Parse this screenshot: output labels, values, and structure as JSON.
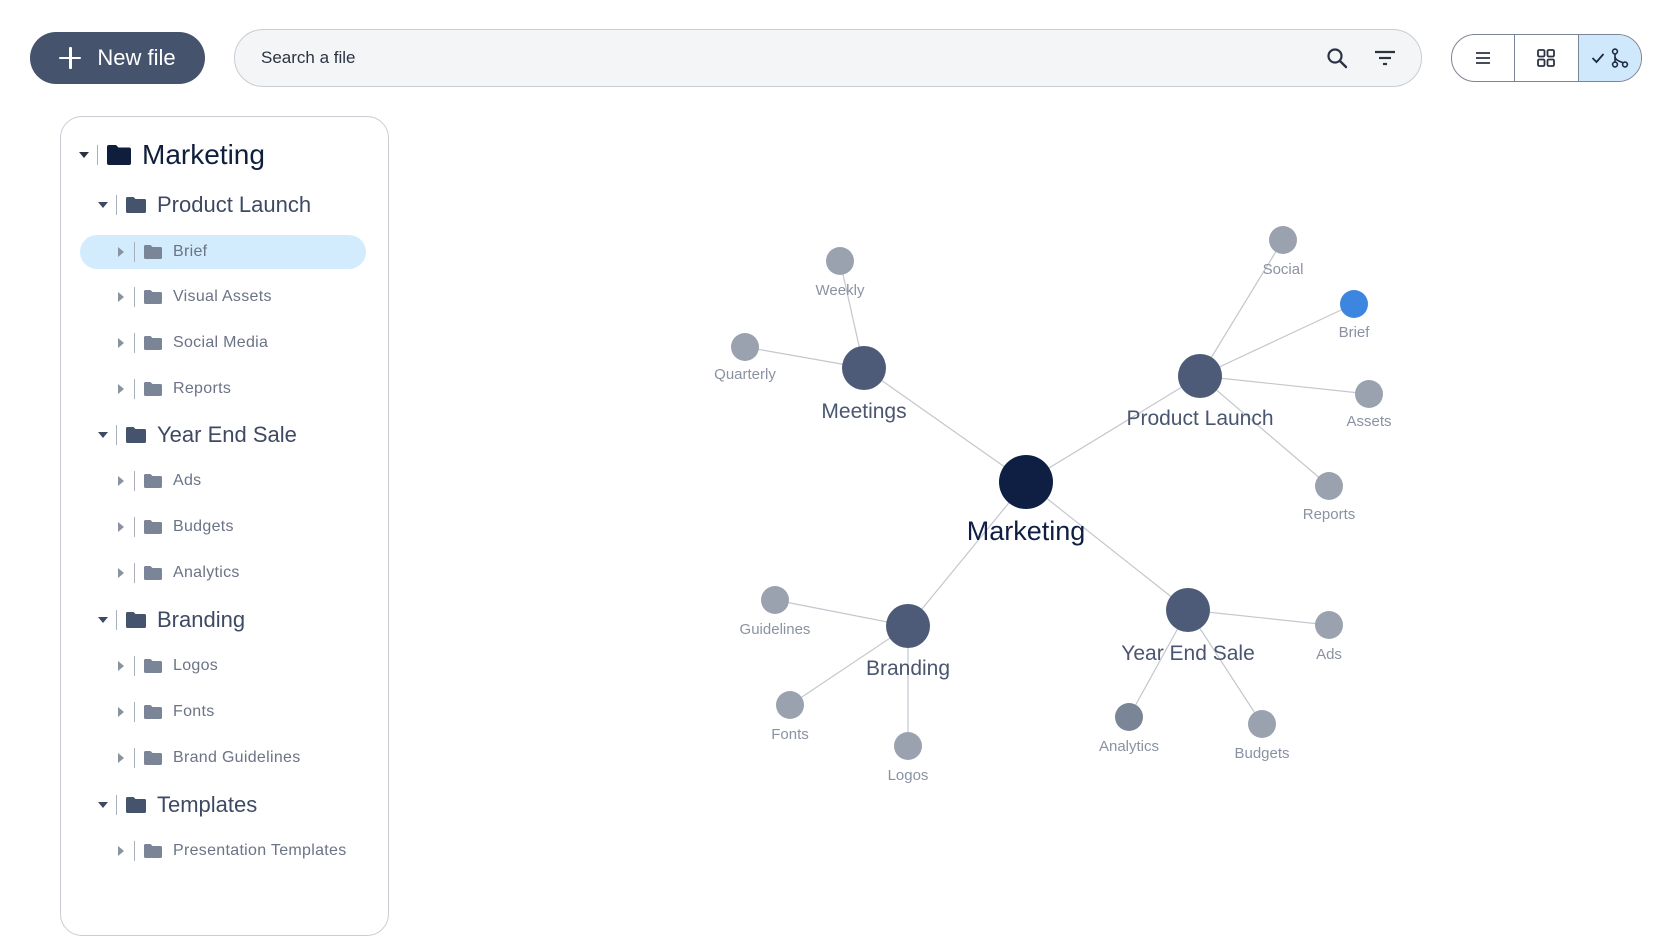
{
  "toolbar": {
    "new_file_label": "New file",
    "search_placeholder": "Search a file",
    "search_icon": "search-icon",
    "filter_icon": "filter-icon",
    "views": [
      {
        "name": "list-view",
        "icon": "list-icon"
      },
      {
        "name": "grid-view",
        "icon": "grid-icon"
      },
      {
        "name": "graph-view",
        "icon": "graph-icon",
        "active": true
      }
    ]
  },
  "tree": {
    "root": "Marketing",
    "groups": [
      {
        "label": "Product Launch",
        "children": [
          "Brief",
          "Visual Assets",
          "Social Media",
          "Reports"
        ]
      },
      {
        "label": "Year End Sale",
        "children": [
          "Ads",
          "Budgets",
          "Analytics"
        ]
      },
      {
        "label": "Branding",
        "children": [
          "Logos",
          "Fonts",
          "Brand Guidelines"
        ]
      },
      {
        "label": "Templates",
        "children": [
          "Presentation Templates"
        ]
      }
    ],
    "selected": "Brief"
  },
  "graph": {
    "center": "Marketing",
    "hubs": [
      "Meetings",
      "Product Launch",
      "Branding",
      "Year End Sale"
    ],
    "leaves": {
      "meetings": [
        "Weekly",
        "Quarterly"
      ],
      "product_launch": [
        "Social",
        "Brief",
        "Assets",
        "Reports"
      ],
      "branding": [
        "Guidelines",
        "Fonts",
        "Logos"
      ],
      "year_end_sale": [
        "Ads",
        "Analytics",
        "Budgets"
      ]
    },
    "highlighted": "Brief",
    "colors": {
      "center": "#0f1f44",
      "hub": "#4d5b78",
      "leaf": "#9aa2b0",
      "leaf_dark": "#7b8598",
      "highlight": "#3d86e0",
      "edge": "#c3c7ce"
    }
  }
}
